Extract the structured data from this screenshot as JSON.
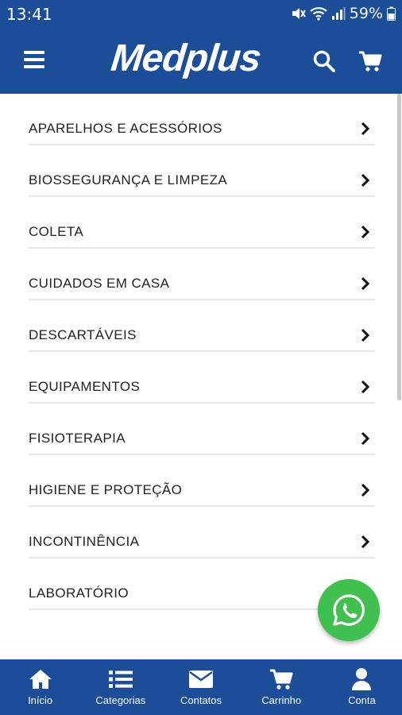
{
  "status_bar": {
    "time": "13:41",
    "battery": "59%"
  },
  "header": {
    "logo": "Medplus",
    "menu_icon": "hamburger-menu-icon",
    "search_icon": "search-icon",
    "cart_icon": "cart-icon"
  },
  "categories": [
    {
      "label": "APARELHOS E ACESSÓRIOS"
    },
    {
      "label": "BIOSSEGURANÇA E LIMPEZA"
    },
    {
      "label": "COLETA"
    },
    {
      "label": "CUIDADOS EM CASA"
    },
    {
      "label": "DESCARTÁVEIS"
    },
    {
      "label": "EQUIPAMENTOS"
    },
    {
      "label": "FISIOTERAPIA"
    },
    {
      "label": "HIGIENE E PROTEÇÃO"
    },
    {
      "label": "INCONTINÊNCIA"
    },
    {
      "label": "LABORATÓRIO"
    }
  ],
  "bottom_nav": [
    {
      "label": "Início",
      "icon": "home-icon"
    },
    {
      "label": "Categorias",
      "icon": "list-icon"
    },
    {
      "label": "Contatos",
      "icon": "envelope-icon"
    },
    {
      "label": "Carrinho",
      "icon": "cart-icon"
    },
    {
      "label": "Conta",
      "icon": "user-icon"
    }
  ],
  "whatsapp_button": {
    "icon": "whatsapp-icon"
  },
  "colors": {
    "brand_blue": "#1b4d99",
    "whatsapp_green": "#3fc04f",
    "divider": "#e6e6e6"
  }
}
